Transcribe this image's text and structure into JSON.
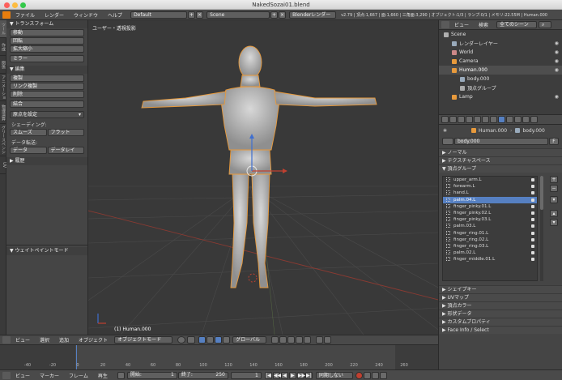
{
  "window": {
    "title": "NakedSozai01.blend"
  },
  "info_header": {
    "menus": [
      "ファイル",
      "レンダー",
      "ウィンドウ",
      "ヘルプ"
    ],
    "layout": "Default",
    "scene": "Scene",
    "engine": "Blenderレンダー",
    "stats": "v2.79 | 頂点:1,667 | 面:1,660 | 三角面:3,290 | オブジェクト:1/3 | ランプ:0/1 | メモリ:22.55M | Human.000"
  },
  "toolshelf": {
    "tabs": [
      "ツール",
      "作成",
      "関係",
      "アニメーション",
      "物理演算",
      "グリースペンシル",
      "UV"
    ],
    "transform": {
      "title": "トランスフォーム",
      "buttons": [
        "移動",
        "回転",
        "拡大縮小",
        "ミラー"
      ]
    },
    "edit": {
      "title": "編集",
      "buttons": [
        "複製",
        "リンク複製",
        "削除",
        "結合"
      ]
    },
    "origin_select": "原点を設定",
    "shading": {
      "label": "シェーディング:",
      "smooth": "スムーズ",
      "flat": "フラット"
    },
    "data_transfer": {
      "label": "データ転送:",
      "data": "データ",
      "data_layout": "データレイ"
    },
    "history": "履歴",
    "weight_paint": "ウェイトペイントモード"
  },
  "viewport": {
    "label": "ユーザー・透視投影",
    "object_label": "(1) Human.000"
  },
  "view3d_header": {
    "menus": [
      "ビュー",
      "選択",
      "追加",
      "オブジェクト"
    ],
    "mode": "オブジェクトモード",
    "orientation": "グローバル"
  },
  "timeline": {
    "ticks": [
      "-40",
      "-20",
      "0",
      "20",
      "40",
      "60",
      "80",
      "100",
      "120",
      "140",
      "160",
      "180",
      "200",
      "220",
      "240",
      "260"
    ],
    "menus": [
      "ビュー",
      "マーカー",
      "フレーム",
      "再生"
    ],
    "start_label": "開始:",
    "start_value": "1",
    "end_label": "終了:",
    "end_value": "250",
    "current_frame": "1",
    "sync": "同期しない"
  },
  "outliner": {
    "tabs": [
      "ビュー",
      "検索"
    ],
    "filter": "全てのシーン",
    "items": [
      {
        "label": "Scene",
        "indent": 0,
        "color": "#b0b0b0"
      },
      {
        "label": "レンダーレイヤー",
        "indent": 1,
        "color": "#9ab"
      },
      {
        "label": "World",
        "indent": 1,
        "color": "#c88"
      },
      {
        "label": "Camera",
        "indent": 1,
        "color": "#e89a3c"
      },
      {
        "label": "Human.000",
        "indent": 1,
        "color": "#e89a3c"
      },
      {
        "label": "body.000",
        "indent": 2,
        "color": "#9ab"
      },
      {
        "label": "頂点グループ",
        "indent": 2,
        "color": "#aaa"
      },
      {
        "label": "Lamp",
        "indent": 1,
        "color": "#e89a3c"
      }
    ]
  },
  "properties": {
    "breadcrumb_object": "Human.000",
    "breadcrumb_mesh": "body.000",
    "mesh_name": "body.000",
    "mesh_flag": "F",
    "sections_top": [
      "ノーマル",
      "テクスチャスペース",
      "頂点グループ"
    ],
    "vertex_groups": [
      "upper_arm.L",
      "forearm.L",
      "hand.L",
      "palm.04.L",
      "finger_pinky.01.L",
      "finger_pinky.02.L",
      "finger_pinky.03.L",
      "palm.03.L",
      "finger_ring.01.L",
      "finger_ring.02.L",
      "finger_ring.03.L",
      "palm.02.L",
      "finger_middle.01.L"
    ],
    "selected_group": "palm.04.L",
    "sections_bottom": [
      "シェイプキー",
      "UVマップ",
      "頂点カラー",
      "形状データ",
      "カスタムプロパティ",
      "Face Info / Select"
    ]
  },
  "colors": {
    "selection_blue": "#5680c2",
    "object_orange": "#e89a3c",
    "accent_red": "#c04030"
  }
}
